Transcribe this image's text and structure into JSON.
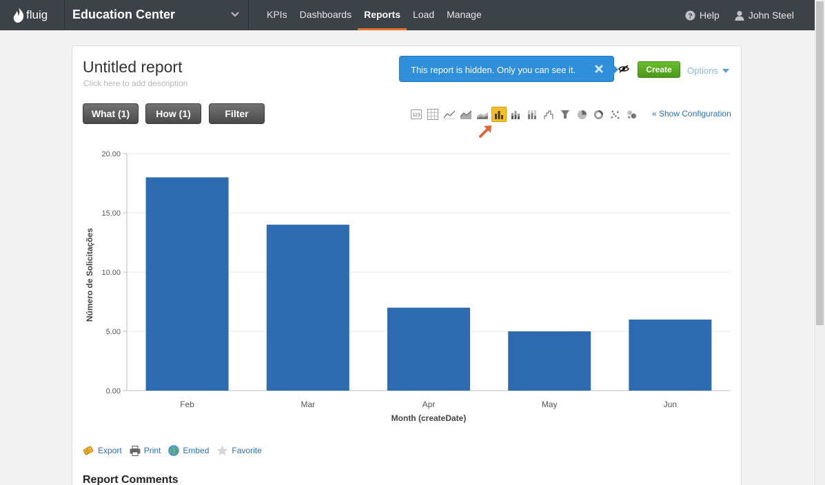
{
  "app": {
    "logo_text": "fluig",
    "title": "Education Center"
  },
  "nav": {
    "items": [
      {
        "label": "KPIs",
        "active": false
      },
      {
        "label": "Dashboards",
        "active": false
      },
      {
        "label": "Reports",
        "active": true
      },
      {
        "label": "Load",
        "active": false
      },
      {
        "label": "Manage",
        "active": false
      }
    ],
    "help_label": "Help",
    "user_name": "John Steel"
  },
  "report": {
    "title": "Untitled report",
    "description_placeholder": "Click here to add description",
    "hidden_notice": "This report is hidden. Only you can see it.",
    "create_label": "Create",
    "options_label": "Options",
    "what_label": "What (1)",
    "how_label": "How (1)",
    "filter_label": "Filter",
    "show_config_label": "« Show Configuration"
  },
  "chart_types": [
    {
      "icon": "number-icon",
      "active": false
    },
    {
      "icon": "table-icon",
      "active": false
    },
    {
      "icon": "line-chart-icon",
      "active": false
    },
    {
      "icon": "area-chart-icon",
      "active": false
    },
    {
      "icon": "stacked-area-icon",
      "active": false
    },
    {
      "icon": "bar-chart-icon",
      "active": true
    },
    {
      "icon": "stacked-bar-icon",
      "active": false
    },
    {
      "icon": "percent-bar-icon",
      "active": false
    },
    {
      "icon": "waterfall-icon",
      "active": false
    },
    {
      "icon": "funnel-icon",
      "active": false
    },
    {
      "icon": "pie-chart-icon",
      "active": false
    },
    {
      "icon": "donut-chart-icon",
      "active": false
    },
    {
      "icon": "scatter-icon",
      "active": false
    },
    {
      "icon": "bubble-icon",
      "active": false
    }
  ],
  "chart_data": {
    "type": "bar",
    "categories": [
      "Feb",
      "Mar",
      "Apr",
      "May",
      "Jun"
    ],
    "values": [
      18,
      14,
      7,
      5,
      6
    ],
    "y_ticks": [
      "0.00",
      "5.00",
      "10.00",
      "15.00",
      "20.00"
    ],
    "xlabel": "Month (createDate)",
    "ylabel": "Número de Solicitações",
    "ylim": [
      0,
      20
    ],
    "grid": true,
    "color": "#2d6bb0"
  },
  "actions": [
    {
      "label": "Export",
      "icon": "export-icon"
    },
    {
      "label": "Print",
      "icon": "printer-icon"
    },
    {
      "label": "Embed",
      "icon": "globe-icon"
    },
    {
      "label": "Favorite",
      "icon": "star-icon"
    }
  ],
  "comments": {
    "title": "Report Comments"
  },
  "colors": {
    "topbar": "#3d4248",
    "accent": "#e8742b",
    "notice": "#2f8fdb",
    "create": "#5aa823"
  }
}
